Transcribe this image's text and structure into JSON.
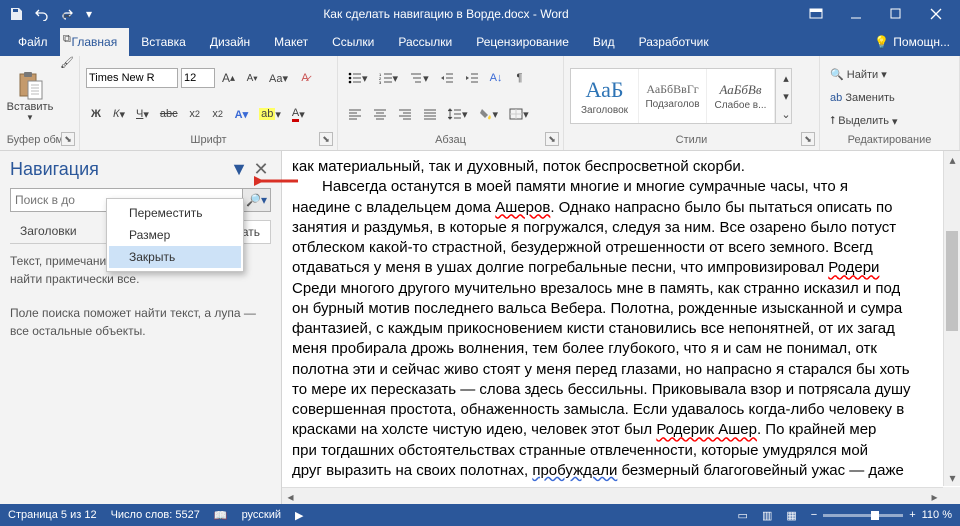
{
  "titlebar": {
    "title": "Как сделать навигацию в Ворде.docx - Word"
  },
  "tabs": [
    "Файл",
    "Главная",
    "Вставка",
    "Дизайн",
    "Макет",
    "Ссылки",
    "Рассылки",
    "Рецензирование",
    "Вид",
    "Разработчик"
  ],
  "active_tab": 1,
  "help": {
    "label": "Помощн..."
  },
  "ribbon": {
    "clipboard": {
      "paste": "Вставить",
      "label": "Буфер обм..."
    },
    "font": {
      "name": "Times New R",
      "size": "12",
      "label": "Шрифт"
    },
    "para": {
      "label": "Абзац"
    },
    "styles": {
      "label": "Стили",
      "items": [
        {
          "preview": "АаБ",
          "name": "Заголовок"
        },
        {
          "preview": "АаБбВвГг",
          "name": "Подзаголов"
        },
        {
          "preview": "АаБбВв",
          "name": "Слабое в..."
        }
      ]
    },
    "editing": {
      "find": "Найти",
      "replace": "Заменить",
      "select": "Выделить",
      "label": "Редактирование"
    }
  },
  "nav": {
    "title": "Навигация",
    "search_placeholder": "Поиск в до",
    "tab1": "Заголовки",
    "tab_last_fragment": "тать",
    "help1": "Текст, примечания, рисунки... Word может найти практически все.",
    "help2": "Поле поиска поможет найти текст, а лупа — все остальные объекты."
  },
  "ctx": {
    "move": "Переместить",
    "size": "Размер",
    "close": "Закрыть"
  },
  "doc": {
    "p1": "как материальный, так и духовный, поток беспросветной скорби.",
    "p2a": "Навсегда останутся в моей памяти многие и многие сумрачные часы, что я",
    "p2b": "наедине с владельцем дома ",
    "p2c": "Ашеров",
    "p2d": ". Однако напрасно было бы пытаться описать по",
    "p3": "занятия и раздумья, в которые я погружался, следуя за ним. Все озарено было потуст",
    "p4": "отблеском какой-то страстной, безудержной отрешенности от всего земного. Всегд",
    "p5a": "отдаваться у меня в ушах долгие погребальные песни, что импровизировал ",
    "p5b": "Родери",
    "p6": "Среди многого другого мучительно врезалось мне в память, как странно исказил и под",
    "p7": "он бурный мотив последнего вальса Вебера. Полотна, рожденные изысканной и сумра",
    "p8": "фантазией, с каждым прикосновением кисти становились все непонятней, от их загад",
    "p9": "меня пробирала дрожь волнения, тем более глубокого, что я и сам не понимал, отк",
    "p10": "полотна эти и сейчас живо стоят у меня перед глазами, но напрасно я старался бы хоть",
    "p11": "то мере их пересказать — слова здесь бессильны. Приковывала взор и потрясала душу",
    "p12": "совершенная простота, обнаженность замысла. Если удавалось когда-либо человеку в",
    "p13a": "красками на холсте чистую идею, человек этот был ",
    "p13b": "Родерик Ашер",
    "p13c": ". По крайней мер",
    "p14": "при тогдашних обстоятельствах странные отвлеченности, которые умудрялся мой ",
    "p15a": "друг выразить на своих полотнах, ",
    "p15b": "пробуждали",
    "p15c": " безмерный благоговейный ужас — даже"
  },
  "status": {
    "page": "Страница 5 из 12",
    "words": "Число слов: 5527",
    "lang": "русский",
    "zoom": "110 %"
  }
}
